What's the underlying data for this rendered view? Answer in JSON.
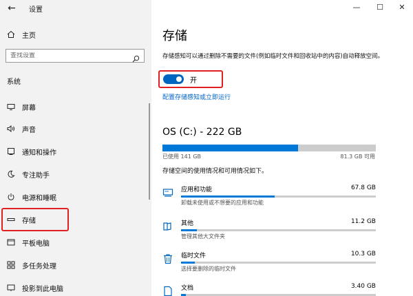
{
  "titlebar": {
    "back": "←",
    "title": "设置",
    "minimize": "—",
    "maximize": "☐",
    "close": "✕"
  },
  "sidebar": {
    "home": "主页",
    "search_placeholder": "查找设置",
    "section": "系统",
    "items": [
      {
        "label": "屏幕",
        "icon": "display-icon"
      },
      {
        "label": "声音",
        "icon": "speaker-icon"
      },
      {
        "label": "通知和操作",
        "icon": "notification-icon"
      },
      {
        "label": "专注助手",
        "icon": "moon-icon"
      },
      {
        "label": "电源和睡眠",
        "icon": "power-icon"
      },
      {
        "label": "存储",
        "icon": "storage-icon",
        "selected": true
      },
      {
        "label": "平板电脑",
        "icon": "tablet-icon"
      },
      {
        "label": "多任务处理",
        "icon": "multitask-icon"
      },
      {
        "label": "投影到此电脑",
        "icon": "project-icon"
      }
    ]
  },
  "main": {
    "title": "存储",
    "description": "存储感知可以通过删除不需要的文件(例如临时文件和回收站中的内容)自动释放空间。",
    "toggle": {
      "state": "开",
      "on": true
    },
    "configure_link": "配置存储感知或立即运行",
    "drive": {
      "title": "OS (C:) - 222 GB",
      "used": "已使用 141 GB",
      "free": "81.3 GB 可用",
      "used_fraction": 0.635
    },
    "usage_desc": "存储空间的使用情况和可用情况如下。",
    "categories": [
      {
        "name": "应用和功能",
        "size": "67.8 GB",
        "sub": "卸载未使用或不想要的应用和功能",
        "fraction": 0.48,
        "icon": "apps-icon"
      },
      {
        "name": "其他",
        "size": "11.2 GB",
        "sub": "管理其他大文件夹",
        "fraction": 0.08,
        "icon": "folder-icon"
      },
      {
        "name": "临时文件",
        "size": "10.3 GB",
        "sub": "选择要删除的临时文件",
        "fraction": 0.07,
        "icon": "trash-icon"
      },
      {
        "name": "文档",
        "size": "3.40 GB",
        "sub": "",
        "fraction": 0.025,
        "icon": "document-icon"
      }
    ]
  },
  "colors": {
    "accent": "#0078d7",
    "highlight": "#e02020",
    "sidebar_bg": "#f2f2f2"
  }
}
